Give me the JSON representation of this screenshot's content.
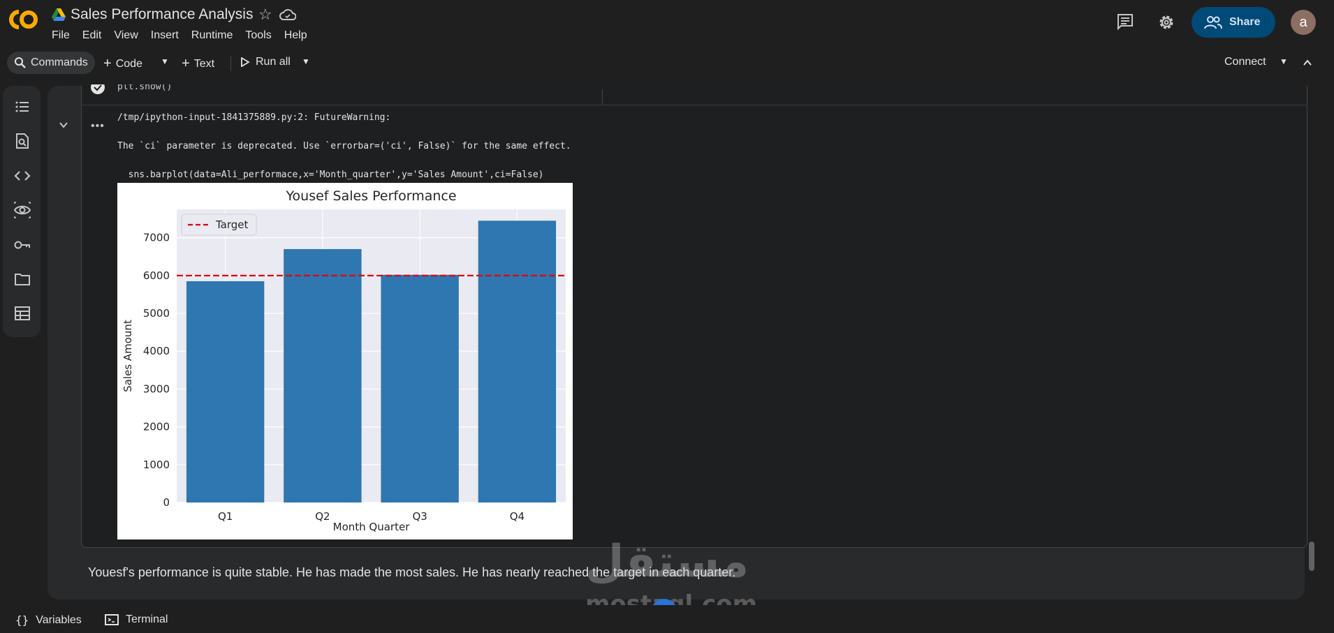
{
  "header": {
    "title": "Sales Performance Analysis",
    "menu": [
      "File",
      "Edit",
      "View",
      "Insert",
      "Runtime",
      "Tools",
      "Help"
    ],
    "share_label": "Share",
    "avatar_letter": "a"
  },
  "toolbar": {
    "commands_label": "Commands",
    "code_label": "Code",
    "text_label": "Text",
    "run_all_label": "Run all",
    "connect_label": "Connect"
  },
  "cell": {
    "code_line": "plt.show()",
    "output_lines": [
      "/tmp/ipython-input-1841375889.py:2: FutureWarning:",
      "The `ci` parameter is deprecated. Use `errorbar=('ci', False)` for the same effect.",
      "  sns.barplot(data=Ali_performace,x='Month_quarter',y='Sales Amount',ci=False)"
    ]
  },
  "chart_data": {
    "type": "bar",
    "title": "Yousef Sales Performance",
    "xlabel": "Month Quarter",
    "ylabel": "Sales Amount",
    "categories": [
      "Q1",
      "Q2",
      "Q3",
      "Q4"
    ],
    "values": [
      5850,
      6700,
      6020,
      7450
    ],
    "ylim": [
      0,
      7750
    ],
    "yticks": [
      0,
      1000,
      2000,
      3000,
      4000,
      5000,
      6000,
      7000
    ],
    "target": 6000,
    "legend": {
      "label": "Target",
      "position": "top-left"
    },
    "bar_color": "#2e77b0",
    "target_color": "#e3000f",
    "grid": true
  },
  "markdown": {
    "text": "Youesf's performance is quite stable. He has made the most sales. He has nearly reached the target in each quarter."
  },
  "bottom": {
    "variables_label": "Variables",
    "terminal_label": "Terminal"
  },
  "watermark": {
    "arabic": "مستقل",
    "latin": "mostaql.com"
  }
}
